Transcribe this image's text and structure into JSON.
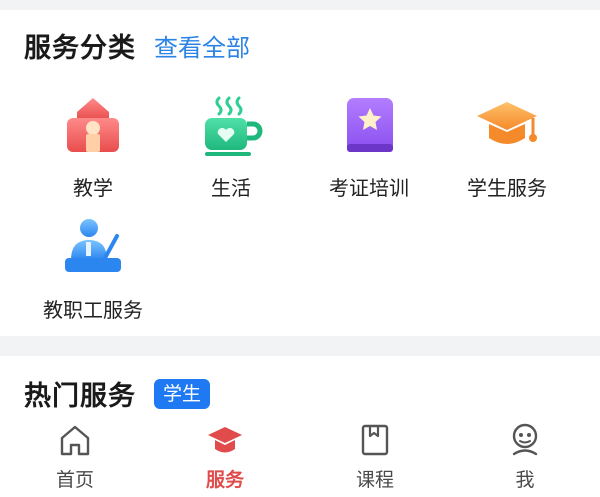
{
  "services_section": {
    "title": "服务分类",
    "view_all": "查看全部",
    "items": [
      {
        "label": "教学",
        "icon": "school-building-icon"
      },
      {
        "label": "生活",
        "icon": "coffee-cup-icon"
      },
      {
        "label": "考证培训",
        "icon": "certificate-book-icon"
      },
      {
        "label": "学生服务",
        "icon": "graduation-cap-icon"
      },
      {
        "label": "教职工服务",
        "icon": "teacher-icon"
      }
    ]
  },
  "hot_section": {
    "title": "热门服务",
    "badge": "学生"
  },
  "tabbar": {
    "tabs": [
      {
        "label": "首页",
        "icon": "home-icon",
        "active": false
      },
      {
        "label": "服务",
        "icon": "service-hat-icon",
        "active": true
      },
      {
        "label": "课程",
        "icon": "book-icon",
        "active": false
      },
      {
        "label": "我",
        "icon": "profile-face-icon",
        "active": false
      }
    ]
  },
  "colors": {
    "accent_blue": "#2a83e5",
    "badge_blue": "#1e79f2",
    "active_red": "#e04b4b",
    "page_bg": "#f2f3f5"
  }
}
